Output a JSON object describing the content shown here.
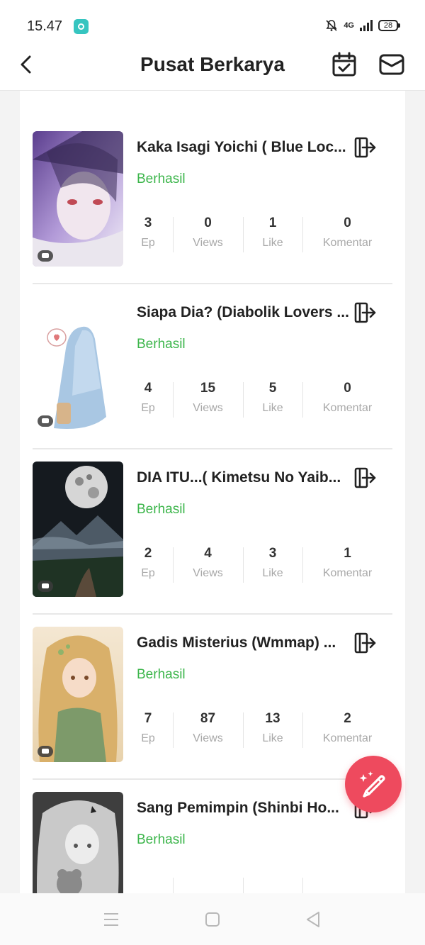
{
  "status_bar": {
    "time": "15.47",
    "network": "4G",
    "battery": "28",
    "icons": [
      "app-notification-icon",
      "bell-muted-icon",
      "signal-icon",
      "battery-icon"
    ]
  },
  "header": {
    "title": "Pusat Berkarya",
    "icons": [
      "back-icon",
      "calendar-check-icon",
      "mail-icon"
    ]
  },
  "works": [
    {
      "title": "Kaka Isagi Yoichi ( Blue Loc...",
      "status": "Berhasil",
      "stats": {
        "ep": "3",
        "views": "0",
        "like": "1",
        "komentar": "0"
      }
    },
    {
      "title": "Siapa Dia? (Diabolik Lovers ...",
      "status": "Berhasil",
      "stats": {
        "ep": "4",
        "views": "15",
        "like": "5",
        "komentar": "0"
      }
    },
    {
      "title": "DIA ITU...( Kimetsu No Yaib...",
      "status": "Berhasil",
      "stats": {
        "ep": "2",
        "views": "4",
        "like": "3",
        "komentar": "1"
      }
    },
    {
      "title": "Gadis Misterius (Wmmap) ...",
      "status": "Berhasil",
      "stats": {
        "ep": "7",
        "views": "87",
        "like": "13",
        "komentar": "2"
      }
    },
    {
      "title": "Sang Pemimpin (Shinbi Ho...",
      "status": "Berhasil",
      "stats": {
        "ep": "",
        "views": "",
        "like": "",
        "komentar": ""
      }
    }
  ],
  "stat_labels": {
    "ep": "Ep",
    "views": "Views",
    "like": "Like",
    "komentar": "Komentar"
  },
  "colors": {
    "success": "#3bb54a",
    "fab": "#ee4a5e"
  },
  "fab": {
    "icon": "pencil-sparkle-icon"
  },
  "nav_bar": {
    "icons": [
      "menu-icon",
      "home-square-icon",
      "back-triangle-icon"
    ]
  }
}
